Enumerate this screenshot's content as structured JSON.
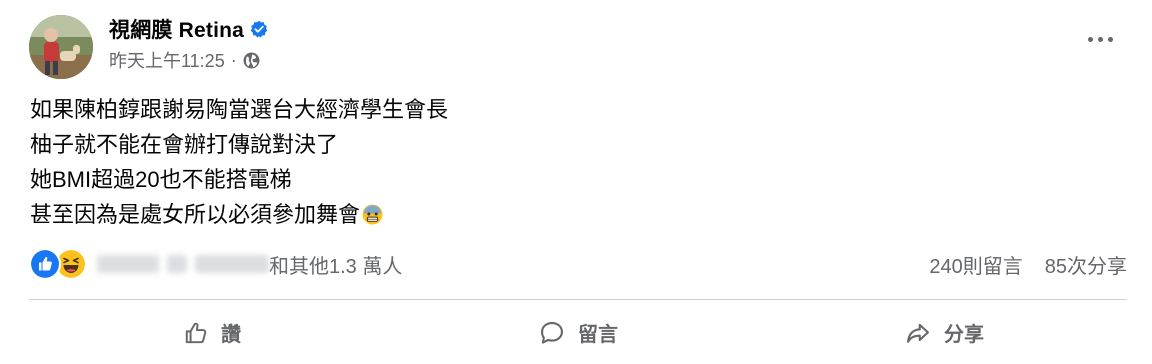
{
  "post": {
    "page_name": "視網膜 Retina",
    "timestamp": "昨天上午11:25",
    "separator": "·",
    "lines": [
      "如果陳柏錞跟謝易陶當選台大經濟學生會長",
      "柚子就不能在會辦打傳說對決了",
      "她BMI超過20也不能搭電梯",
      "甚至因為是處女所以必須參加舞會"
    ]
  },
  "reactions": {
    "others_text": "和其他1.3 萬人",
    "comments_count": "240則留言",
    "shares_count": "85次分享",
    "types": [
      "like",
      "haha"
    ]
  },
  "actions": {
    "like_label": "讚",
    "comment_label": "留言",
    "share_label": "分享"
  },
  "icons": [
    "verified-badge-icon",
    "globe-icon",
    "more-options-icon",
    "like-reaction-icon",
    "haha-reaction-icon",
    "anxious-face-emoji",
    "thumbs-up-icon",
    "comment-bubble-icon",
    "share-arrow-icon"
  ],
  "colors": {
    "facebook_blue": "#1877f2",
    "secondary_text": "#65676b",
    "primary_text": "#050505",
    "divider": "#ced0d4"
  }
}
